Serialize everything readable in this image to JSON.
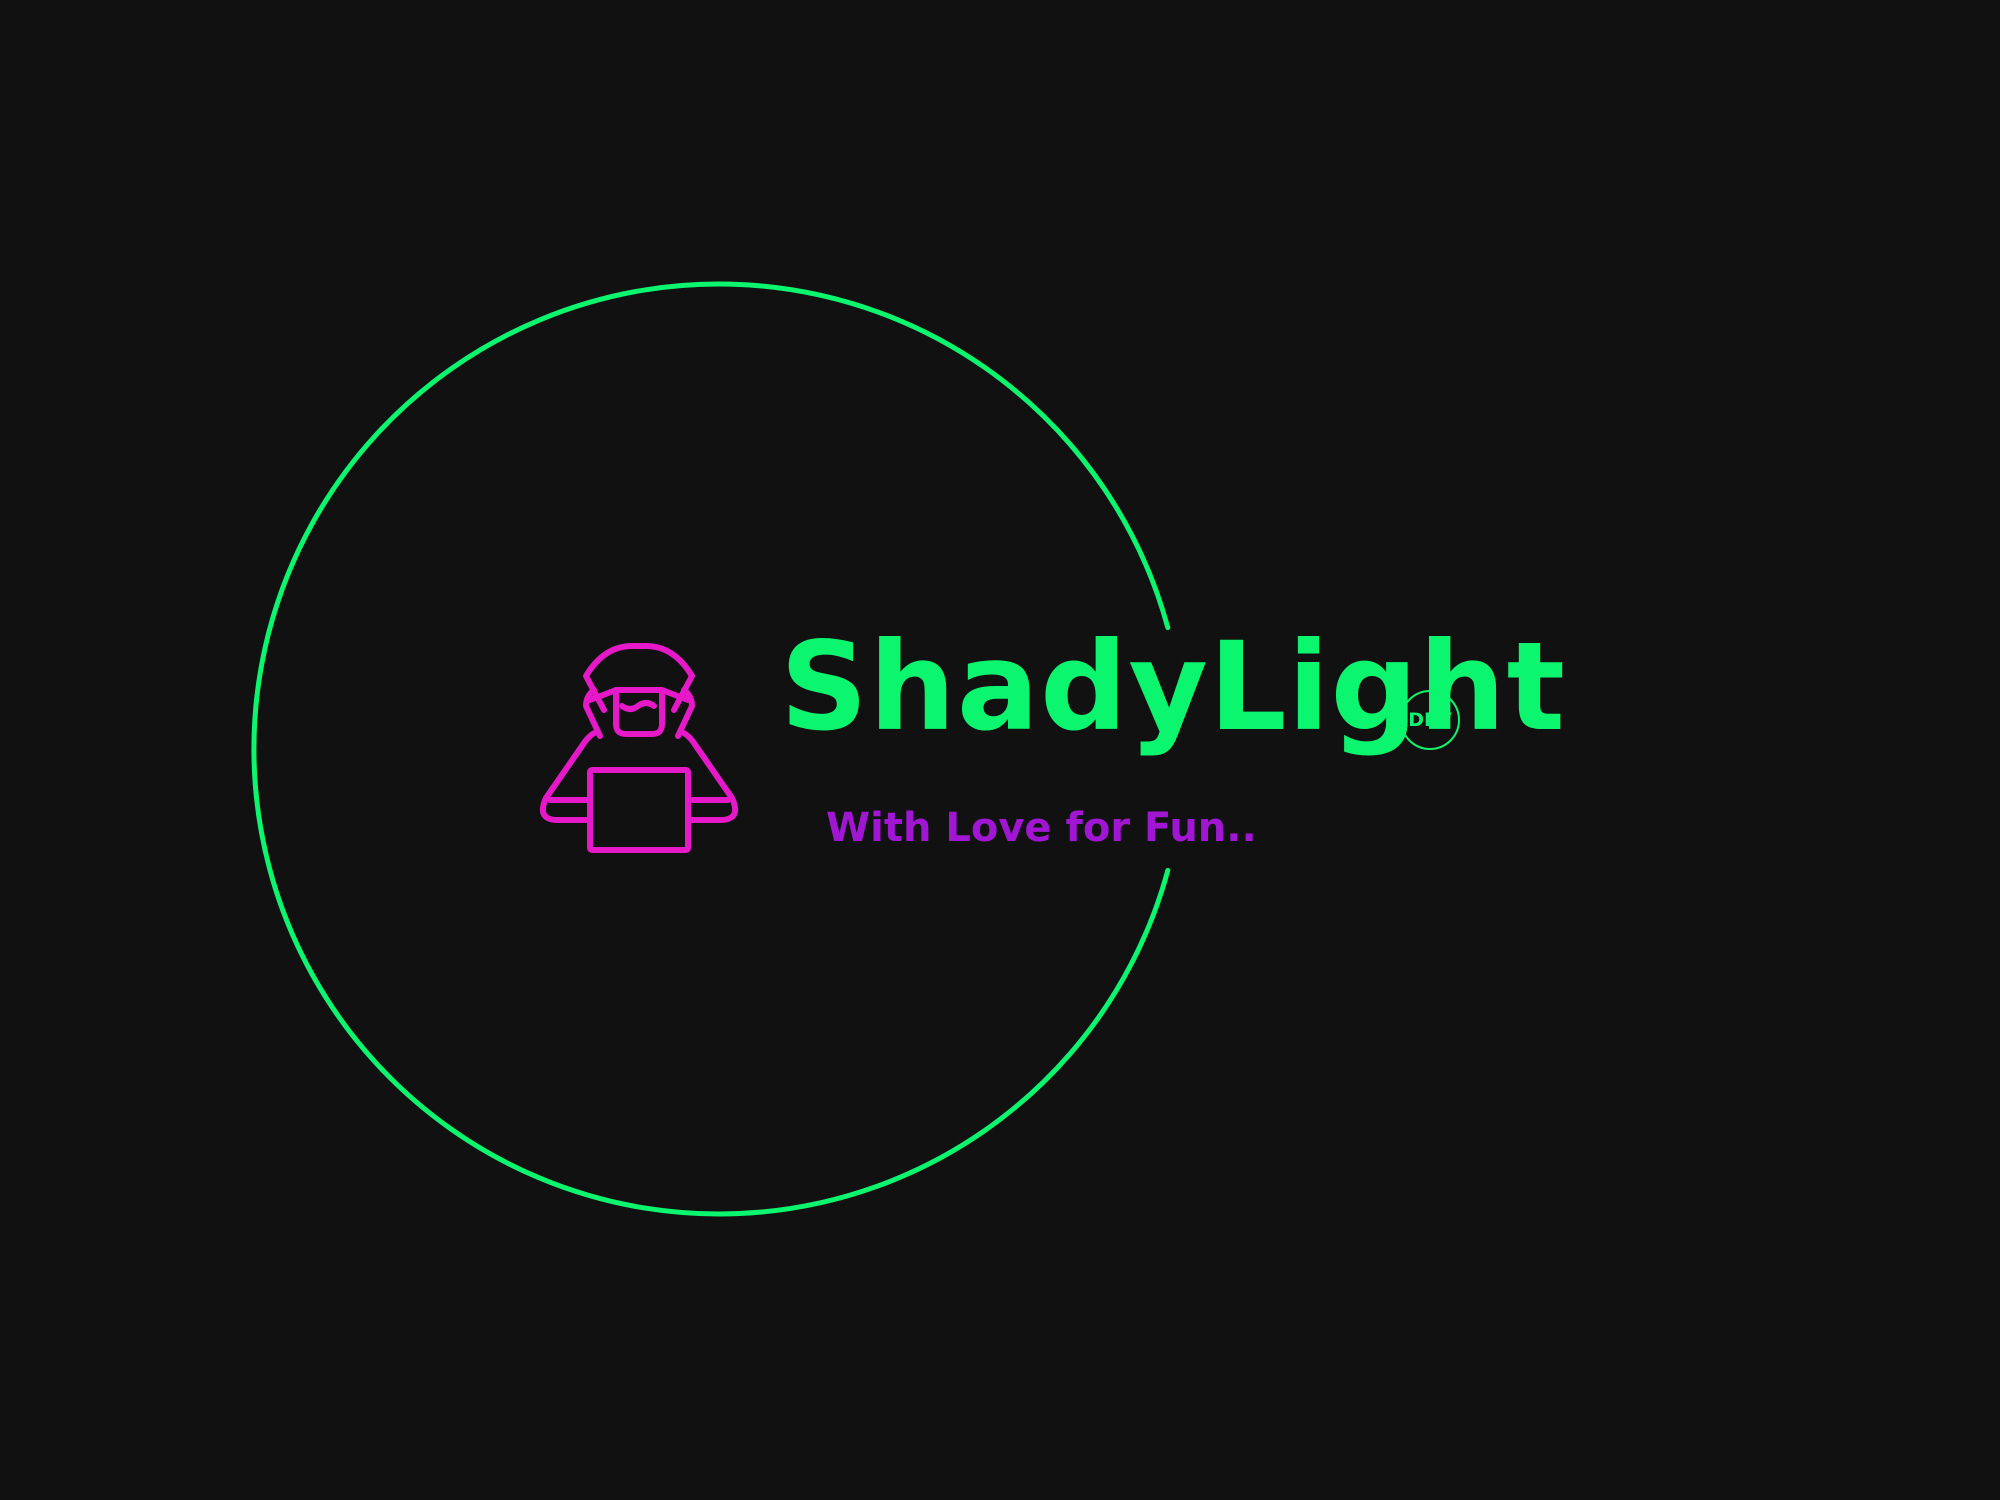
{
  "logo": {
    "brand_name": "ShadyLight",
    "badge_text": "DEV",
    "tagline": "With Love for Fun..",
    "emblem_icon": "hooded-hacker-laptop-icon",
    "ring_icon": "open-ring-arc"
  },
  "colors": {
    "background": "#111111",
    "brand_green": "#0BF56E",
    "hacker_magenta": "#E619C8",
    "tagline_purple": "#A016D2"
  }
}
